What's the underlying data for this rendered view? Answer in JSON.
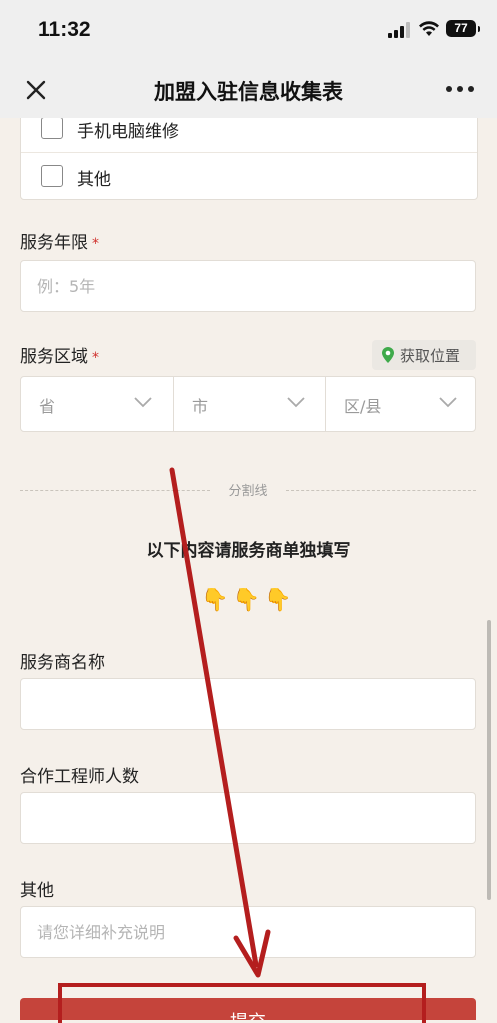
{
  "status_bar": {
    "time": "11:32",
    "battery": "77"
  },
  "nav": {
    "title": "加盟入驻信息收集表"
  },
  "options": [
    {
      "label": "手机电脑维修",
      "checked": false
    },
    {
      "label": "其他",
      "checked": false
    }
  ],
  "fields": {
    "service_years": {
      "label": "服务年限",
      "required_mark": "*",
      "placeholder": "例：5年",
      "value": ""
    },
    "service_area": {
      "label": "服务区域",
      "required_mark": "*",
      "locate_label": "获取位置",
      "province": "省",
      "city": "市",
      "district": "区/县"
    },
    "provider_name": {
      "label": "服务商名称",
      "value": ""
    },
    "engineer_count": {
      "label": "合作工程师人数",
      "value": ""
    },
    "other": {
      "label": "其他",
      "placeholder": "请您详细补充说明",
      "value": ""
    }
  },
  "divider": {
    "text": "分割线"
  },
  "notice": {
    "text": "以下内容请服务商单独填写",
    "emoji": "👇👇👇"
  },
  "submit": {
    "label": "提交"
  },
  "colors": {
    "accent": "#c5443b",
    "annotation": "#b41e1e",
    "background": "#f5f0ea",
    "location_green": "#3faa4b"
  }
}
